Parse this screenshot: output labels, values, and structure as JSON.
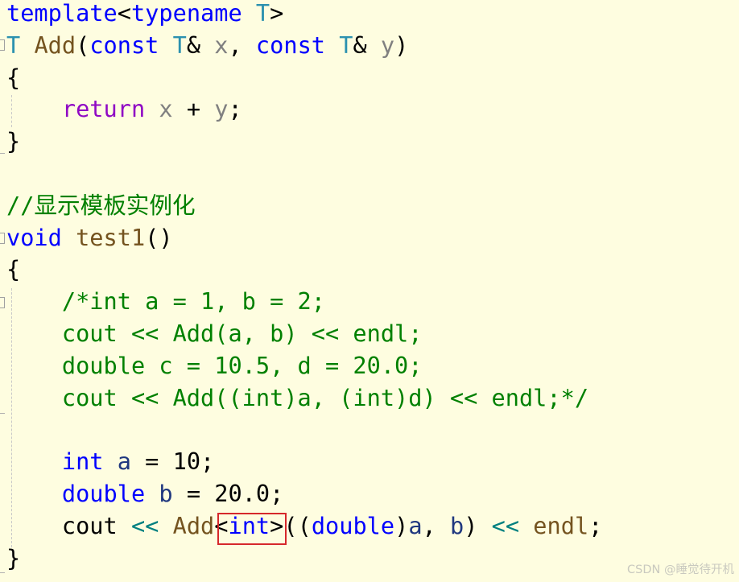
{
  "editor": {
    "lines": [
      [
        {
          "t": "template",
          "c": "kw"
        },
        {
          "t": "<",
          "c": "pl"
        },
        {
          "t": "typename",
          "c": "kw"
        },
        {
          "t": " ",
          "c": "pl"
        },
        {
          "t": "T",
          "c": "tp"
        },
        {
          "t": ">",
          "c": "pl"
        }
      ],
      [
        {
          "t": "T",
          "c": "tp"
        },
        {
          "t": " ",
          "c": "pl"
        },
        {
          "t": "Add",
          "c": "fn"
        },
        {
          "t": "(",
          "c": "pl"
        },
        {
          "t": "const",
          "c": "kw"
        },
        {
          "t": " ",
          "c": "pl"
        },
        {
          "t": "T",
          "c": "tp"
        },
        {
          "t": "& ",
          "c": "pl"
        },
        {
          "t": "x",
          "c": "pm"
        },
        {
          "t": ", ",
          "c": "pl"
        },
        {
          "t": "const",
          "c": "kw"
        },
        {
          "t": " ",
          "c": "pl"
        },
        {
          "t": "T",
          "c": "tp"
        },
        {
          "t": "& ",
          "c": "pl"
        },
        {
          "t": "y",
          "c": "pm"
        },
        {
          "t": ")",
          "c": "pl"
        }
      ],
      [
        {
          "t": "{",
          "c": "pl"
        }
      ],
      [
        {
          "t": "    ",
          "c": "pl"
        },
        {
          "t": "return",
          "c": "ctl"
        },
        {
          "t": " ",
          "c": "pl"
        },
        {
          "t": "x",
          "c": "pm"
        },
        {
          "t": " + ",
          "c": "pl"
        },
        {
          "t": "y",
          "c": "pm"
        },
        {
          "t": ";",
          "c": "pl"
        }
      ],
      [
        {
          "t": "}",
          "c": "pl"
        }
      ],
      [],
      [
        {
          "t": "//显示模板实例化",
          "c": "cm"
        }
      ],
      [
        {
          "t": "void",
          "c": "kw"
        },
        {
          "t": " ",
          "c": "pl"
        },
        {
          "t": "test1",
          "c": "fn"
        },
        {
          "t": "()",
          "c": "pl"
        }
      ],
      [
        {
          "t": "{",
          "c": "pl"
        }
      ],
      [
        {
          "t": "    ",
          "c": "pl"
        },
        {
          "t": "/*int a = 1, b = 2;",
          "c": "cm"
        }
      ],
      [
        {
          "t": "    ",
          "c": "pl"
        },
        {
          "t": "cout << Add(a, b) << endl;",
          "c": "cm"
        }
      ],
      [
        {
          "t": "    ",
          "c": "pl"
        },
        {
          "t": "double c = 10.5, d = 20.0;",
          "c": "cm"
        }
      ],
      [
        {
          "t": "    ",
          "c": "pl"
        },
        {
          "t": "cout << Add((int)a, (int)d) << endl;*/",
          "c": "cm"
        }
      ],
      [],
      [
        {
          "t": "    ",
          "c": "pl"
        },
        {
          "t": "int",
          "c": "kw"
        },
        {
          "t": " ",
          "c": "pl"
        },
        {
          "t": "a",
          "c": "lv"
        },
        {
          "t": " = 10;",
          "c": "pl"
        }
      ],
      [
        {
          "t": "    ",
          "c": "pl"
        },
        {
          "t": "double",
          "c": "kw"
        },
        {
          "t": " ",
          "c": "pl"
        },
        {
          "t": "b",
          "c": "lv"
        },
        {
          "t": " = 20.0;",
          "c": "pl"
        }
      ],
      [
        {
          "t": "    ",
          "c": "pl"
        },
        {
          "t": "cout",
          "c": "pl"
        },
        {
          "t": " ",
          "c": "pl"
        },
        {
          "t": "<<",
          "c": "op"
        },
        {
          "t": " ",
          "c": "pl"
        },
        {
          "t": "Add",
          "c": "fn"
        },
        {
          "t": "<",
          "c": "pl"
        },
        {
          "t": "int",
          "c": "kw"
        },
        {
          "t": ">",
          "c": "pl"
        },
        {
          "t": "((",
          "c": "pl"
        },
        {
          "t": "double",
          "c": "kw"
        },
        {
          "t": ")",
          "c": "pl"
        },
        {
          "t": "a",
          "c": "lv"
        },
        {
          "t": ", ",
          "c": "pl"
        },
        {
          "t": "b",
          "c": "lv"
        },
        {
          "t": ") ",
          "c": "pl"
        },
        {
          "t": "<<",
          "c": "op"
        },
        {
          "t": " ",
          "c": "pl"
        },
        {
          "t": "endl",
          "c": "fn"
        },
        {
          "t": ";",
          "c": "pl"
        }
      ],
      [
        {
          "t": "}",
          "c": "pl"
        }
      ]
    ],
    "highlight": {
      "text": "<int>",
      "color": "#d6282b"
    }
  },
  "watermark": "CSDN @睡觉待开机"
}
